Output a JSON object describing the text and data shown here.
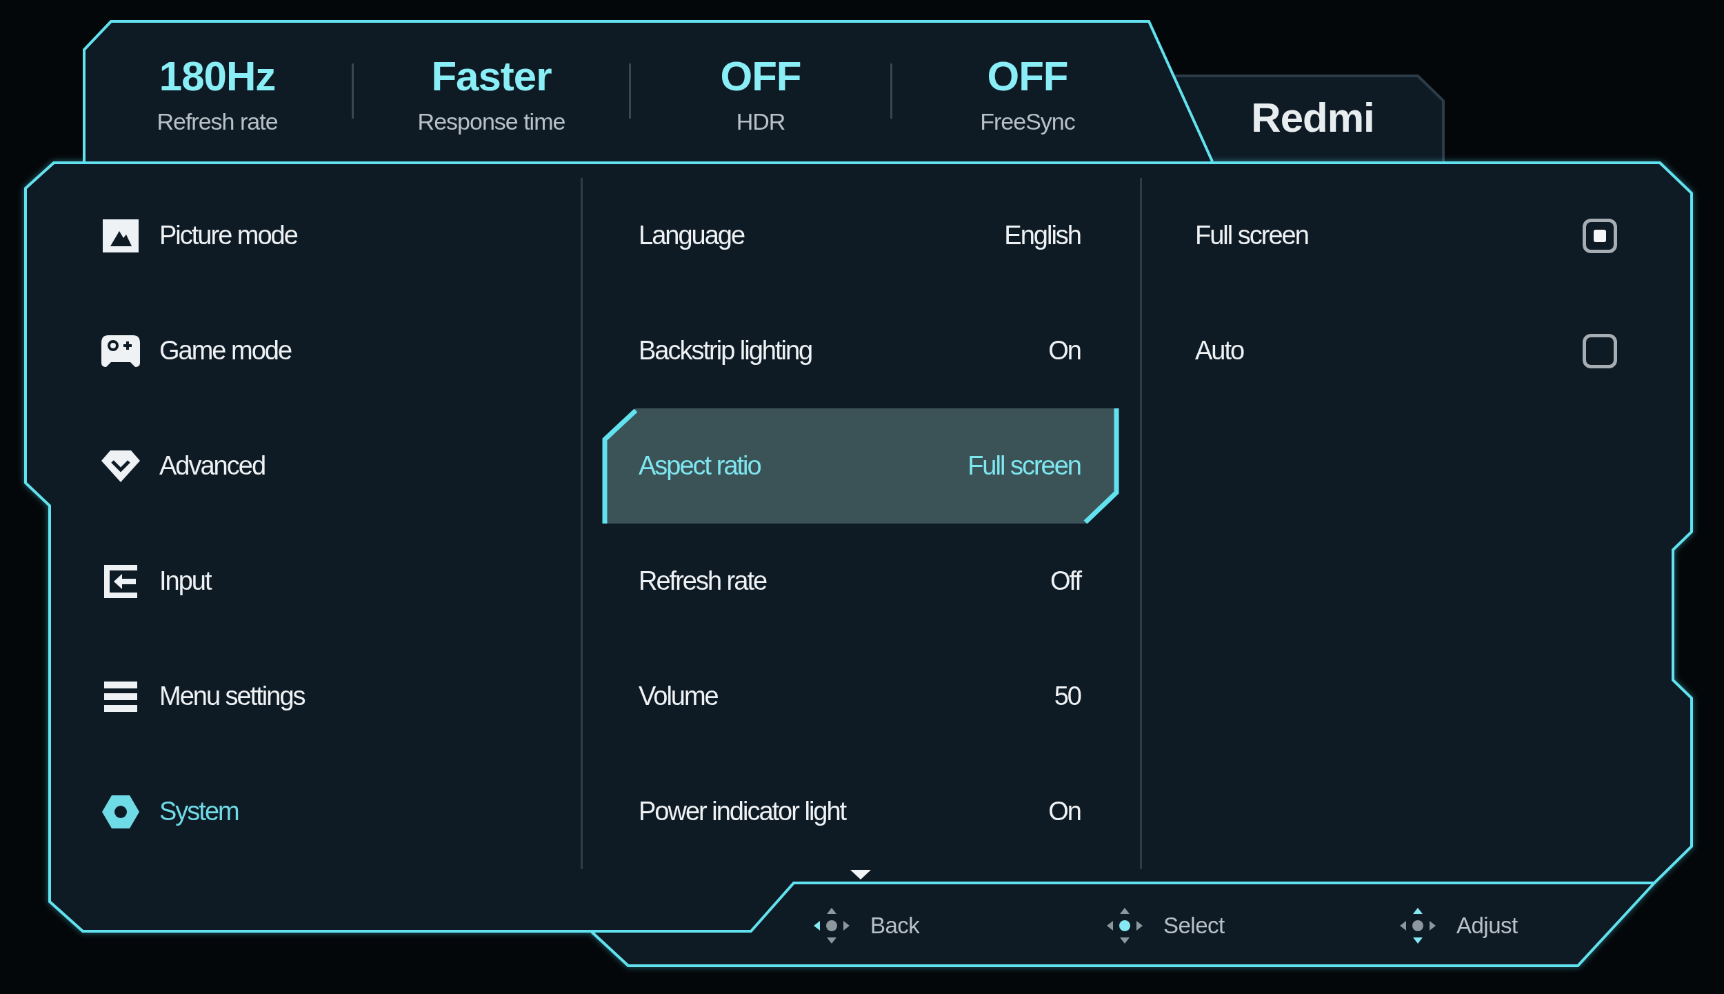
{
  "status_bar": [
    {
      "value": "180Hz",
      "label": "Refresh rate"
    },
    {
      "value": "Faster",
      "label": "Response time"
    },
    {
      "value": "OFF",
      "label": "HDR"
    },
    {
      "value": "OFF",
      "label": "FreeSync"
    }
  ],
  "brand": "Redmi",
  "menu": [
    {
      "label": "Picture mode",
      "selected": false
    },
    {
      "label": "Game mode",
      "selected": false
    },
    {
      "label": "Advanced",
      "selected": false
    },
    {
      "label": "Input",
      "selected": false
    },
    {
      "label": "Menu settings",
      "selected": false
    },
    {
      "label": "System",
      "selected": true
    }
  ],
  "settings": [
    {
      "label": "Language",
      "value": "English",
      "selected": false
    },
    {
      "label": "Backstrip lighting",
      "value": "On",
      "selected": false
    },
    {
      "label": "Aspect ratio",
      "value": "Full screen",
      "selected": true
    },
    {
      "label": "Refresh rate",
      "value": "Off",
      "selected": false
    },
    {
      "label": "Volume",
      "value": "50",
      "selected": false
    },
    {
      "label": "Power indicator light",
      "value": "On",
      "selected": false
    }
  ],
  "options": [
    {
      "label": "Full screen",
      "selected": true
    },
    {
      "label": "Auto",
      "selected": false
    }
  ],
  "footer": [
    {
      "label": "Back",
      "kind": "left"
    },
    {
      "label": "Select",
      "kind": "center"
    },
    {
      "label": "Adjust",
      "kind": "vertical"
    }
  ]
}
